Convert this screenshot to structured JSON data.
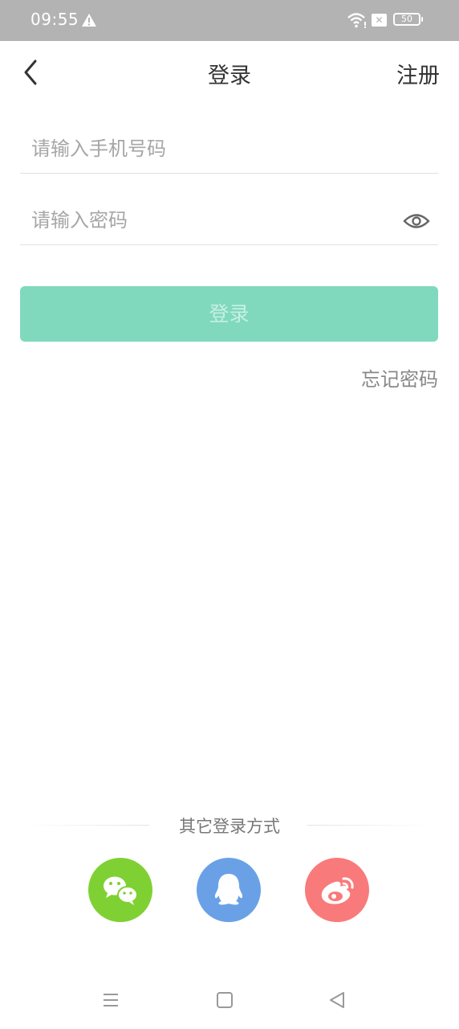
{
  "status_bar": {
    "time": "09:55",
    "battery": "50",
    "icons": [
      "warning-icon",
      "wifi-icon",
      "sim-off-icon",
      "battery-icon"
    ]
  },
  "header": {
    "title": "登录",
    "register_label": "注册",
    "back_icon": "chevron-left-icon"
  },
  "form": {
    "phone_placeholder": "请输入手机号码",
    "phone_value": "",
    "password_placeholder": "请输入密码",
    "password_value": "",
    "eye_icon": "eye-icon",
    "login_label": "登录",
    "forgot_label": "忘记密码"
  },
  "other_login": {
    "title": "其它登录方式",
    "providers": [
      {
        "name": "wechat",
        "icon": "wechat-icon",
        "color": "#7fd133"
      },
      {
        "name": "qq",
        "icon": "qq-icon",
        "color": "#6aa1e6"
      },
      {
        "name": "weibo",
        "icon": "weibo-icon",
        "color": "#f97a7a"
      }
    ]
  },
  "colors": {
    "status_bar": "#b3b3b3",
    "login_button": "#80d9bd",
    "login_button_text": "#c7efe2"
  },
  "nav_bar": {
    "icons": [
      "menu-icon",
      "home-square-icon",
      "back-triangle-icon"
    ]
  }
}
